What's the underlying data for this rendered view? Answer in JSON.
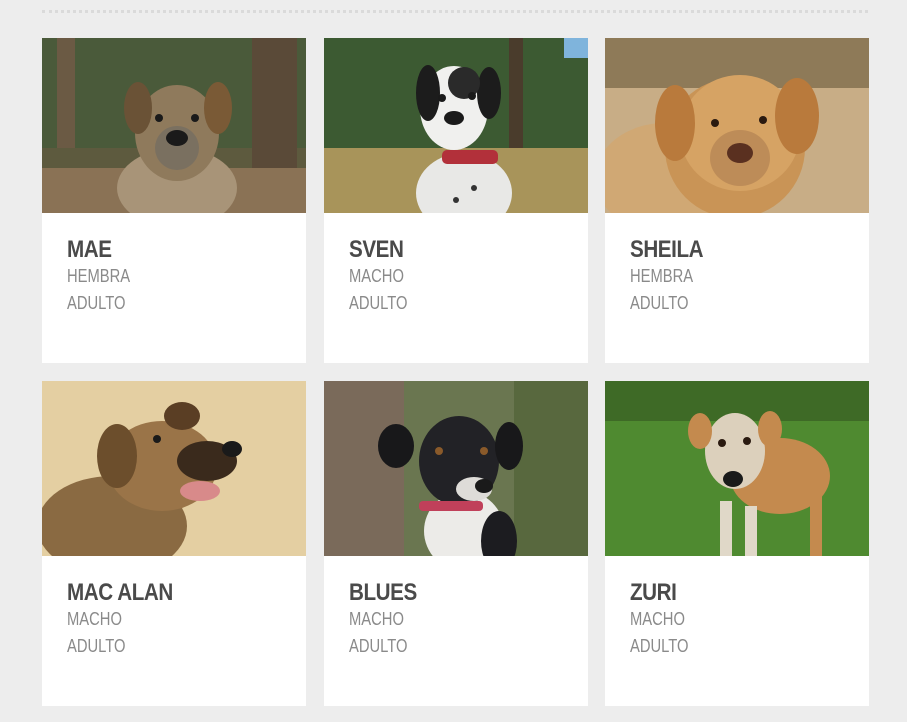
{
  "dogs": [
    {
      "name": "MAE",
      "sex": "HEMBRA",
      "age": "ADULTO",
      "photo_icon": "dog-photo-mae"
    },
    {
      "name": "SVEN",
      "sex": "MACHO",
      "age": "ADULTO",
      "photo_icon": "dog-photo-sven"
    },
    {
      "name": "SHEILA",
      "sex": "HEMBRA",
      "age": "ADULTO",
      "photo_icon": "dog-photo-sheila"
    },
    {
      "name": "MAC ALAN",
      "sex": "MACHO",
      "age": "ADULTO",
      "photo_icon": "dog-photo-mac-alan"
    },
    {
      "name": "BLUES",
      "sex": "MACHO",
      "age": "ADULTO",
      "photo_icon": "dog-photo-blues"
    },
    {
      "name": "ZURI",
      "sex": "MACHO",
      "age": "ADULTO",
      "photo_icon": "dog-photo-zuri"
    }
  ]
}
